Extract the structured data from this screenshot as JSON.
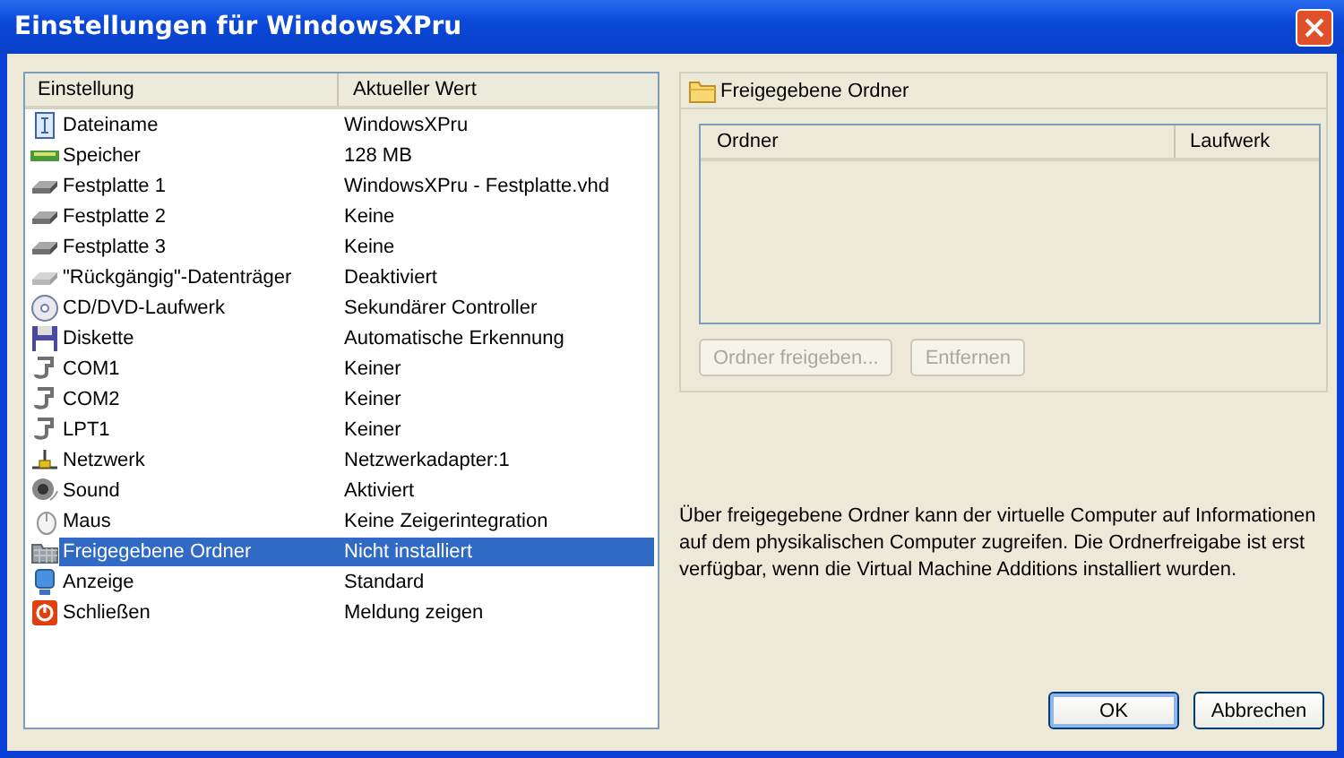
{
  "window": {
    "title": "Einstellungen für WindowsXPru"
  },
  "settings": {
    "columns": [
      "Einstellung",
      "Aktueller Wert"
    ],
    "rows": [
      {
        "kind": "info",
        "name": "Dateiname",
        "value": "WindowsXPru",
        "selected": false
      },
      {
        "kind": "memory",
        "name": "Speicher",
        "value": "128 MB",
        "selected": false
      },
      {
        "kind": "disk",
        "name": "Festplatte 1",
        "value": "WindowsXPru - Festplatte.vhd",
        "selected": false
      },
      {
        "kind": "disk",
        "name": "Festplatte 2",
        "value": "Keine",
        "selected": false
      },
      {
        "kind": "disk",
        "name": "Festplatte 3",
        "value": "Keine",
        "selected": false
      },
      {
        "kind": "undo-disk",
        "name": "\"Rückgängig\"-Datenträger",
        "value": "Deaktiviert",
        "selected": false
      },
      {
        "kind": "cd",
        "name": "CD/DVD-Laufwerk",
        "value": "Sekundärer Controller",
        "selected": false
      },
      {
        "kind": "floppy",
        "name": "Diskette",
        "value": "Automatische Erkennung",
        "selected": false
      },
      {
        "kind": "port",
        "name": "COM1",
        "value": "Keiner",
        "selected": false
      },
      {
        "kind": "port",
        "name": "COM2",
        "value": "Keiner",
        "selected": false
      },
      {
        "kind": "port",
        "name": "LPT1",
        "value": "Keiner",
        "selected": false
      },
      {
        "kind": "network",
        "name": "Netzwerk",
        "value": "Netzwerkadapter:1",
        "selected": false
      },
      {
        "kind": "sound",
        "name": "Sound",
        "value": "Aktiviert",
        "selected": false
      },
      {
        "kind": "mouse",
        "name": "Maus",
        "value": "Keine Zeigerintegration",
        "selected": false
      },
      {
        "kind": "shared",
        "name": "Freigegebene Ordner",
        "value": "Nicht installiert",
        "selected": true
      },
      {
        "kind": "display",
        "name": "Anzeige",
        "value": "Standard",
        "selected": false
      },
      {
        "kind": "close",
        "name": "Schließen",
        "value": "Meldung zeigen",
        "selected": false
      }
    ]
  },
  "detail": {
    "title": "Freigegebene Ordner",
    "columns": [
      "Ordner",
      "Laufwerk"
    ],
    "buttons": [
      {
        "label": "Ordner freigeben...",
        "disabled": true
      },
      {
        "label": "Entfernen",
        "disabled": true
      }
    ],
    "description": "Über freigegebene Ordner kann der virtuelle Computer auf Informationen auf dem physikalischen Computer zugreifen. Die Ordnerfreigabe ist erst verfügbar, wenn die Virtual Machine Additions installiert wurden."
  },
  "buttons": [
    {
      "label": "OK",
      "default": true
    },
    {
      "label": "Abbrechen",
      "default": false
    }
  ]
}
